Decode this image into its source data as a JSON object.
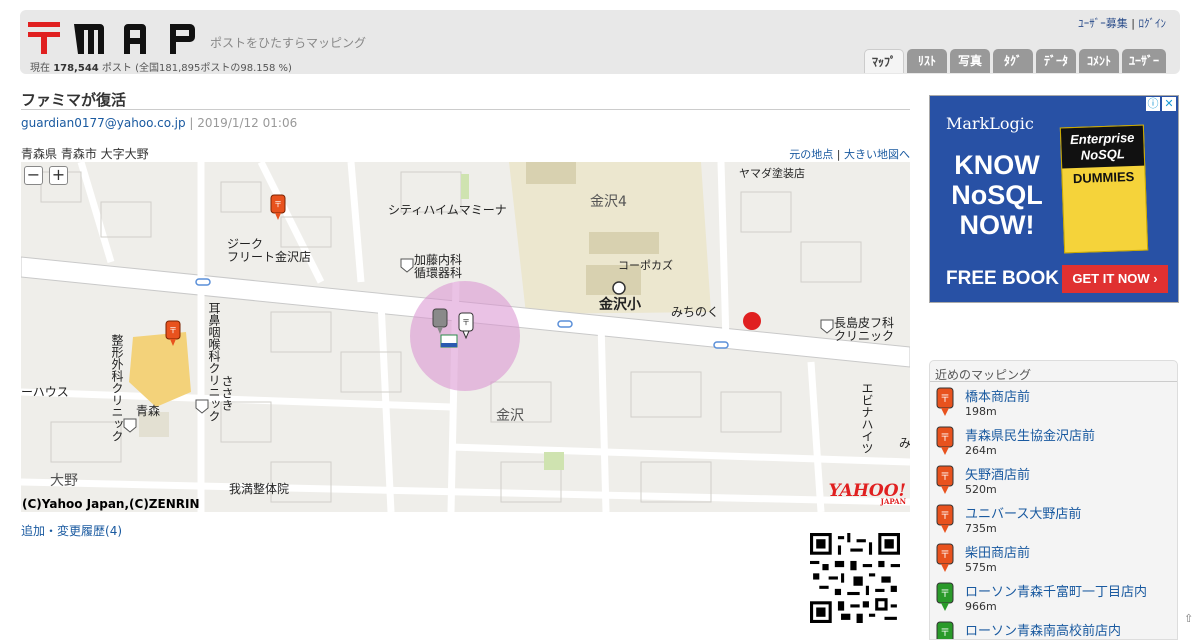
{
  "header": {
    "logo_text": "〒MAP",
    "tagline": "ポストをひたすらマッピング",
    "stats_prefix": "現在",
    "stats_count": "178,544",
    "stats_suffix": "ポスト (全国181,895ポストの98.158 %)",
    "user_recruit": "ﾕｰｻﾞｰ募集",
    "login": "ﾛｸﾞｲﾝ",
    "tabs": [
      {
        "label": "ﾏｯﾌﾟ",
        "active": true
      },
      {
        "label": "ﾘｽﾄ",
        "active": false
      },
      {
        "label": "写真",
        "active": false
      },
      {
        "label": "ﾀｸﾞ",
        "active": false
      },
      {
        "label": "ﾃﾞｰﾀ",
        "active": false
      },
      {
        "label": "ｺﾒﾝﾄ",
        "active": false
      },
      {
        "label": "ﾕｰｻﾞｰ",
        "active": false
      }
    ]
  },
  "post": {
    "title": "ファミマが復活",
    "author": "guardian0177@yahoo.co.jp",
    "datetime": "2019/1/12 01:06",
    "address": "青森県 青森市 大字大野",
    "link_origin": "元の地点",
    "link_bigmap": "大きい地図へ"
  },
  "map": {
    "zoom_out": "−",
    "zoom_in": "+",
    "copyright": "(C)Yahoo Japan,(C)ZENRIN",
    "provider_logo": "YAHOO!",
    "provider_sub": "JAPAN",
    "labels": {
      "l1": "シティハイムマミーナ",
      "l2": "ジーク",
      "l3": "フリート金沢店",
      "l4": "加藤内科",
      "l5": "循環器科",
      "l6": "金沢4",
      "l7": "ヤマダ塗装店",
      "l8": "コーポカズ",
      "l9": "金沢小",
      "l10": "みちのく",
      "l11": "長島皮フ科",
      "l12": "クリニック",
      "l13": "整形外科クリニック",
      "l14": "耳鼻咽喉科クリニック",
      "l15": "ささき",
      "l16": "青森",
      "l17": "ーハウス",
      "l18": "金沢",
      "l19": "大野",
      "l20": "我満整体院",
      "l21": "エビナハイツ",
      "l22": "み"
    }
  },
  "actions": {
    "add": "追加",
    "sep": "・",
    "history": "変更履歴(4)"
  },
  "ad": {
    "info_icon": "ⓘ",
    "close_icon": "✕",
    "brand": "MarkLogic",
    "headline": "KNOW NoSQL NOW!",
    "book_title": "Enterprise NoSQL",
    "book_sub": "DUMMIES",
    "free": "FREE BOOK",
    "cta": "GET IT NOW ›"
  },
  "nearby": {
    "title": "近めのマッピング",
    "items": [
      {
        "name": "橋本商店前",
        "dist": "198m",
        "color": "#e8521e"
      },
      {
        "name": "青森県民生協金沢店前",
        "dist": "264m",
        "color": "#e8521e"
      },
      {
        "name": "矢野酒店前",
        "dist": "520m",
        "color": "#e8521e"
      },
      {
        "name": "ユニバース大野店前",
        "dist": "735m",
        "color": "#e8521e"
      },
      {
        "name": "柴田商店前",
        "dist": "575m",
        "color": "#e8521e"
      },
      {
        "name": "ローソン青森千富町一丁目店内",
        "dist": "966m",
        "color": "#2a9a2a"
      },
      {
        "name": "ローソン青森南高校前店内",
        "dist": "",
        "color": "#2a9a2a"
      }
    ]
  },
  "colors": {
    "brand_red": "#e02020",
    "link_blue": "#1a5aa0",
    "tab_gray": "#999999",
    "ad_blue": "#2851a5",
    "highlight_circle": "#d98fd0"
  },
  "scroll_top_icon": "⇧"
}
